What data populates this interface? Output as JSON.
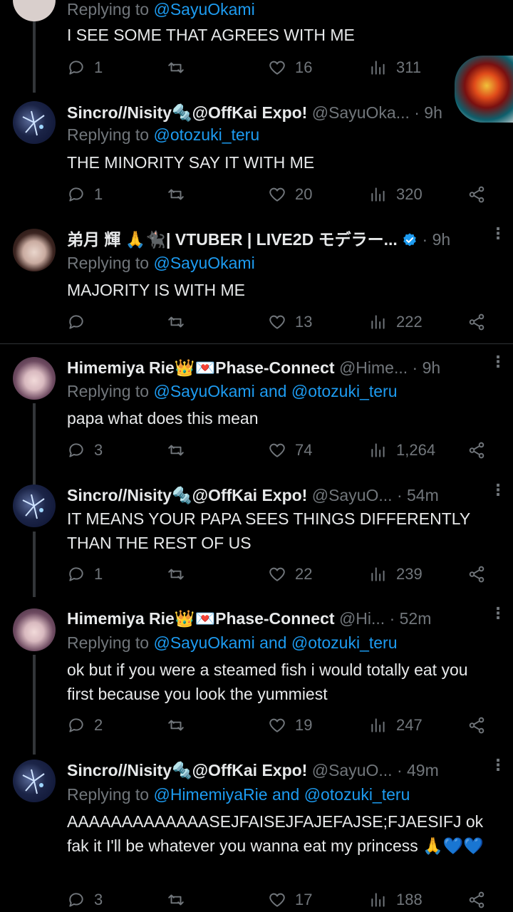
{
  "tweets": [
    {
      "name": "",
      "handle": "",
      "time": "",
      "reply_prefix": "Replying to ",
      "reply_to": "@SayuOkami",
      "text": "I SEE SOME THAT AGREES WITH ME",
      "replies": "1",
      "retweets": "",
      "likes": "16",
      "views": "311"
    },
    {
      "name": "Sincro//Nisity🔩@OffKai Expo!",
      "handle": "@SayuOka...",
      "time": "· 9h",
      "reply_prefix": "Replying to ",
      "reply_to": "@otozuki_teru",
      "text": "THE MINORITY SAY IT WITH ME",
      "replies": "1",
      "retweets": "",
      "likes": "20",
      "views": "320"
    },
    {
      "name": "弟月 輝 🙏🐈‍⬛| VTUBER | LIVE2D モデラー...",
      "handle": "",
      "time": "· 9h",
      "reply_prefix": "Replying to ",
      "reply_to": "@SayuOkami",
      "text": "MAJORITY IS WITH ME",
      "replies": "",
      "retweets": "",
      "likes": "13",
      "views": "222"
    },
    {
      "name": "Himemiya Rie👑💌Phase-Connect",
      "handle": "@Hime...",
      "time": "· 9h",
      "reply_prefix": "Replying to ",
      "reply_to": "@SayuOkami and @otozuki_teru",
      "text": "papa what does this mean",
      "replies": "3",
      "retweets": "",
      "likes": "74",
      "views": "1,264"
    },
    {
      "name": "Sincro//Nisity🔩@OffKai Expo!",
      "handle": "@SayuO...",
      "time": "· 54m",
      "reply_prefix": "",
      "reply_to": "",
      "text": "IT MEANS YOUR PAPA SEES THINGS DIFFERENTLY THAN THE REST OF US",
      "replies": "1",
      "retweets": "",
      "likes": "22",
      "views": "239"
    },
    {
      "name": "Himemiya Rie👑💌Phase-Connect",
      "handle": "@Hi...",
      "time": "· 52m",
      "reply_prefix": "Replying to ",
      "reply_to": "@SayuOkami and @otozuki_teru",
      "text": "ok but if you were a steamed fish i would totally eat you first because you look the yummiest",
      "replies": "2",
      "retweets": "",
      "likes": "19",
      "views": "247"
    },
    {
      "name": "Sincro//Nisity🔩@OffKai Expo!",
      "handle": "@SayuO...",
      "time": "· 49m",
      "reply_prefix": "Replying to ",
      "reply_to": "@HimemiyaRie and @otozuki_teru",
      "text": "AAAAAAAAAAAAASEJFAISEJFAJEFAJSE;FJAESIFJ ok fak it I'll be whatever you wanna eat my princess 🙏💙💙",
      "replies": "3",
      "retweets": "",
      "likes": "17",
      "views": "188"
    }
  ]
}
